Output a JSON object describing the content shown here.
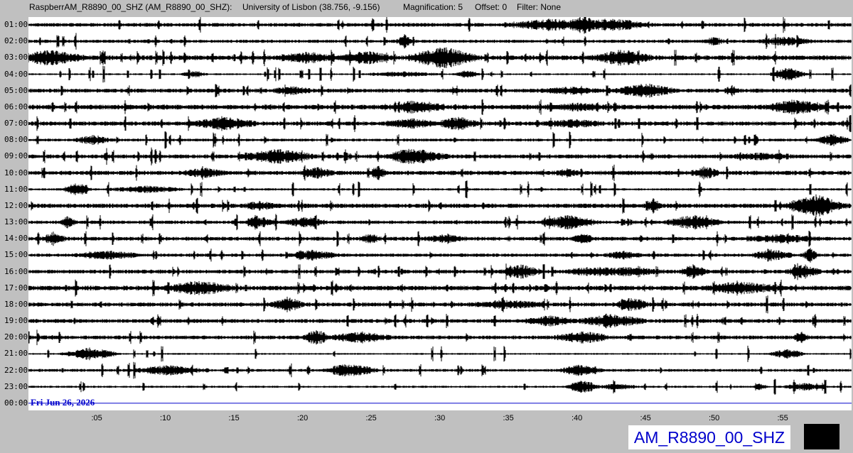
{
  "header": {
    "station": "RaspberrAM_R8890_00_SHZ (AM_R8890_00_SHZ):",
    "location": "University of Lisbon (38.756, -9.156)",
    "magnification": "Magnification: 5",
    "offset": "Offset: 0",
    "filter": "Filter: None"
  },
  "hours": [
    "01:00",
    "02:00",
    "03:00",
    "04:00",
    "05:00",
    "06:00",
    "07:00",
    "08:00",
    "09:00",
    "10:00",
    "11:00",
    "12:00",
    "13:00",
    "14:00",
    "15:00",
    "16:00",
    "17:00",
    "18:00",
    "19:00",
    "20:00",
    "21:00",
    "22:00",
    "23:00",
    "00:00"
  ],
  "minutes": [
    ":05",
    ":10",
    ":15",
    ":20",
    ":25",
    ":30",
    ":35",
    ":40",
    ":45",
    ":50",
    ":55"
  ],
  "date_label": "Fri Jun 26, 2026",
  "station_code": "AM_R8890_00_SHZ",
  "colors": {
    "trace": "#000000",
    "current_line": "#0000cc",
    "label_blue": "#0000cc",
    "background": "#c0c0c0"
  }
}
